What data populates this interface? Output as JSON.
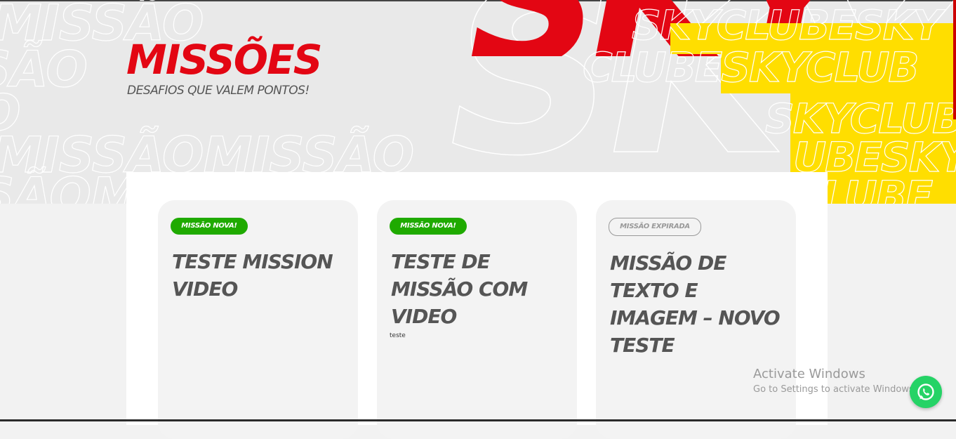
{
  "hero": {
    "title": "MISSÕES",
    "subtitle": "DESAFIOS QUE VALEM PONTOS!",
    "accent_red": "#e30613",
    "accent_yellow": "#ffde00"
  },
  "missions": [
    {
      "badge": "MISSÃO NOVA!",
      "status": "new",
      "title": "TESTE MISSION VIDEO",
      "description": ""
    },
    {
      "badge": "MISSÃO NOVA!",
      "status": "new",
      "title": "TESTE DE MISSÃO COM VIDEO",
      "description": "teste"
    },
    {
      "badge": "MISSÃO EXPIRADA",
      "status": "expired",
      "title": "MISSÃO DE TEXTO E IMAGEM – NOVO TESTE",
      "description": ""
    }
  ],
  "status_colors": {
    "new": "#1faa00",
    "expired": "#999999"
  },
  "windows_watermark": {
    "line1": "Activate Windows",
    "line2": "Go to Settings to activate Windows."
  },
  "whatsapp": {
    "icon": "whatsapp-icon",
    "color": "#25d366"
  }
}
